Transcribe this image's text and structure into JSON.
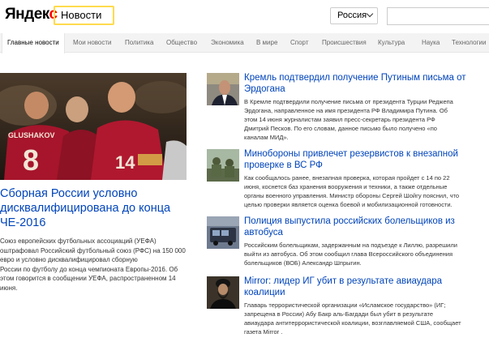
{
  "header": {
    "logo_main": "Яндек",
    "logo_end": "с",
    "service_tab": "Новости",
    "region": "Россия",
    "search_value": ""
  },
  "nav": {
    "items": [
      "Главные новости",
      "Мои новости",
      "Политика",
      "Общество",
      "Экономика",
      "В мире",
      "Спорт",
      "Происшествия",
      "Культура",
      "Наука",
      "Технологии"
    ],
    "active_index": 0
  },
  "hero": {
    "player_name": "GLUSHAKOV",
    "player_number": "8",
    "title": "Сборная России условно дисквалифицирована до конца ЧЕ-2016",
    "lines": [
      "Союз европейских футбольных ассоциаций (УЕФА)",
      "оштрафовал Российский футбольный союз (РФС) на 150 000",
      "евро и условно дисквалифицировал сборную",
      "России по футболу до конца чемпионата Европы-2016. Об",
      "этом говорится в сообщении УЕФА, распространенном 14",
      "июня."
    ]
  },
  "news": [
    {
      "icon": "portrait-photo",
      "title_lines": [
        "Кремль подтвердил получение Путиным письма от",
        "Эрдогана"
      ],
      "lines": [
        "В Кремле подтвердили получение письма от президента Турции Реджепа",
        "Эрдогана, направленное на имя президента РФ Владимира Путина. Об",
        "этом 14 июня журналистам заявил пресс-секретарь президента РФ",
        "Дмитрий Песков. По его словам, данное письмо было получено «по",
        "каналам МИД»."
      ]
    },
    {
      "icon": "soldiers-photo",
      "title_lines": [
        "Минобороны привлечет резервистов к внезапной",
        "проверке в ВС РФ"
      ],
      "lines": [
        "Как сообщалось ранее, внезапная проверка, которая пройдет с 14 по 22",
        "июня, коснется баз хранения вооружения и техники, а также отдельные",
        "органы военного управления. Министр обороны Сергей Шойгу пояснил, что",
        "целью проверки является оценка боевой и мобилизационной готовности."
      ]
    },
    {
      "icon": "bus-photo",
      "title_lines": [
        "Полиция выпустила российских болельщиков из",
        "автобуса"
      ],
      "lines": [
        "Российским болельщикам, задержанным на подъезде к Лиллю, разрешили",
        "выйти из автобуса. Об этом сообщил глава Всероссийского объединения",
        "болельщиков (ВОБ) Александр Шпрыгин."
      ]
    },
    {
      "icon": "bearded-man-photo",
      "title_lines": [
        "Mirror: лидер ИГ убит в результате авиаудара",
        "коалиции"
      ],
      "lines": [
        "Главарь террористической организации «Исламское государство» (ИГ;",
        "запрещена в России) Абу Бакр аль-Багдади был убит в результате",
        "авиаудара антитеррористической коалиции, возглавляемой США, сообщает",
        "газета Mirror ."
      ]
    }
  ]
}
